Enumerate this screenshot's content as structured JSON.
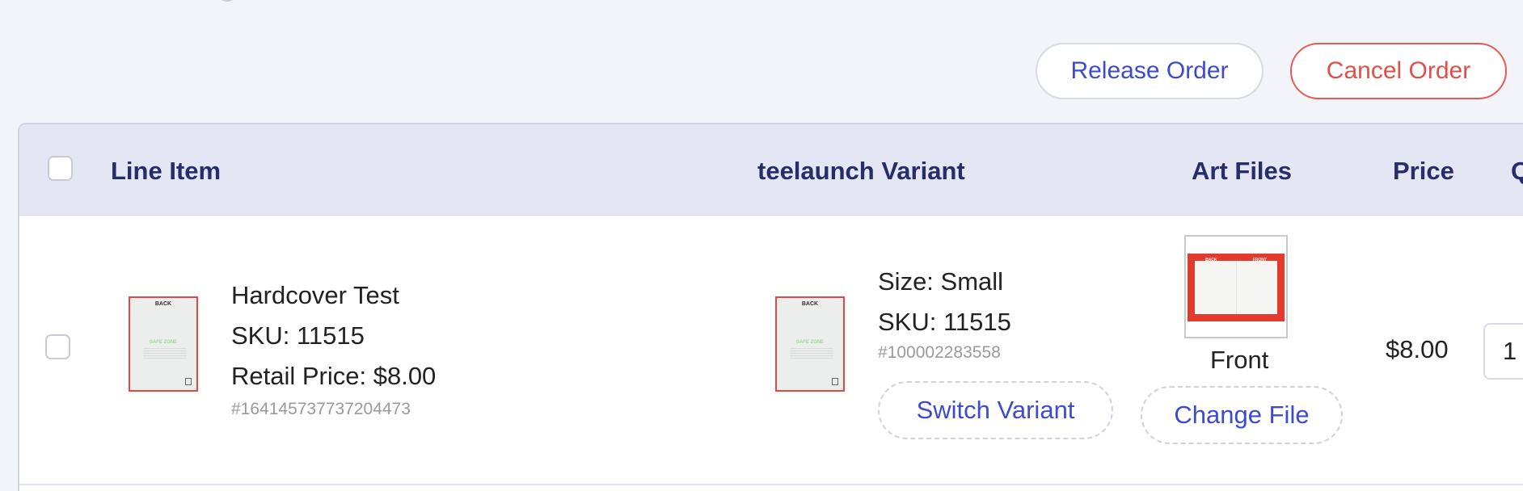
{
  "actions": {
    "release_label": "Release Order",
    "cancel_label": "Cancel Order"
  },
  "table": {
    "headers": {
      "line_item": "Line Item",
      "variant": "teelaunch Variant",
      "art_files": "Art Files",
      "price": "Price",
      "qty_partial": "Q"
    },
    "rows": [
      {
        "name": "Hardcover Test",
        "sku": "SKU: 11515",
        "retail_price": "Retail Price: $8.00",
        "line_id": "#164145737737204473",
        "thumb_back_label": "BACK",
        "thumb_safe_label": "SAFE ZONE",
        "variant": {
          "size": "Size: Small",
          "sku": "SKU: 11515",
          "id": "#100002283558",
          "switch_label": "Switch Variant",
          "thumb_back_label": "BACK",
          "thumb_safe_label": "SAFE ZONE"
        },
        "art": {
          "back_label": "BACK",
          "front_label": "FRONT",
          "caption": "Front",
          "change_label": "Change File"
        },
        "price": "$8.00",
        "quantity": "1"
      }
    ]
  },
  "colors": {
    "accent": "#3c4bcf",
    "danger": "#e14f4a",
    "header_bg": "#e4e6f3",
    "header_text": "#252d6b"
  }
}
